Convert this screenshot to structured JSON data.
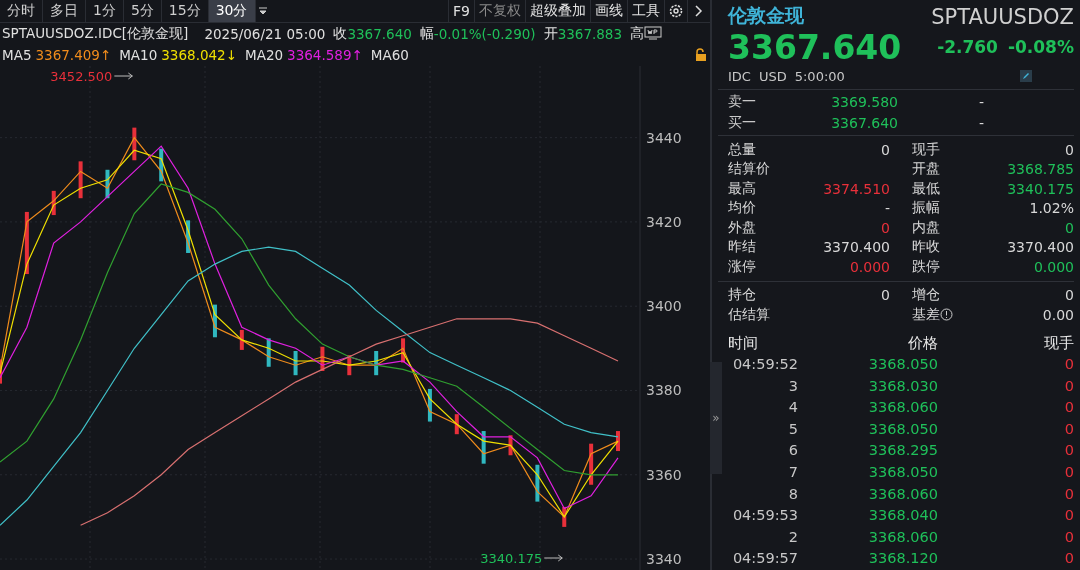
{
  "toolbar": {
    "periods": [
      {
        "label": "分时",
        "selected": false
      },
      {
        "label": "多日",
        "selected": false
      },
      {
        "label": "1分",
        "selected": false
      },
      {
        "label": "5分",
        "selected": false
      },
      {
        "label": "15分",
        "selected": false
      },
      {
        "label": "30分",
        "selected": true
      }
    ],
    "tools": [
      {
        "label": "F9",
        "disabled": false
      },
      {
        "label": "不复权",
        "disabled": true
      },
      {
        "label": "超级叠加",
        "disabled": false
      },
      {
        "label": "画线",
        "disabled": false
      },
      {
        "label": "工具",
        "disabled": false
      }
    ]
  },
  "info_bar": {
    "symbol": "SPTAUUSDOZ.IDC[伦敦金现]",
    "datetime": "2025/06/21 05:00",
    "fields": [
      {
        "label": "收",
        "value": "3367.640",
        "color": "#1fc05a"
      },
      {
        "label": "幅",
        "value": "-0.01%(-0.290)",
        "color": "#1fc05a"
      },
      {
        "label": "开",
        "value": "3367.883",
        "color": "#1fc05a"
      },
      {
        "label": "高"
      }
    ]
  },
  "ma_legend": [
    {
      "name": "MA5",
      "value": "3367.409↑",
      "color": "#f08c1c"
    },
    {
      "name": "MA10",
      "value": "3368.042↓",
      "color": "#f0e000"
    },
    {
      "name": "MA20",
      "value": "3364.589↑",
      "color": "#e020e0"
    },
    {
      "name": "MA60"
    }
  ],
  "chart": {
    "chart_data": {
      "type": "line",
      "ylim": [
        3337.4,
        3457
      ],
      "yticks": [
        3340,
        3360,
        3380,
        3400,
        3420,
        3440
      ],
      "grid": true,
      "series": [
        {
          "color": "#f08c1c",
          "values": [
            3385,
            3420,
            3425,
            3432,
            3428,
            3440,
            3432,
            3415,
            3395,
            3392,
            3388,
            3386,
            3388,
            3386,
            3386,
            3390,
            3375,
            3372,
            3365,
            3367,
            3356,
            3350,
            3365,
            3368
          ]
        },
        {
          "color": "#f0e000",
          "values": [
            3384,
            3410,
            3424,
            3428,
            3430,
            3437,
            3435,
            3418,
            3398,
            3392,
            3390,
            3387,
            3387,
            3386,
            3387,
            3389,
            3378,
            3372,
            3368,
            3367,
            3360,
            3350,
            3360,
            3368
          ]
        },
        {
          "color": "#e020e0",
          "values": [
            3383,
            3395,
            3415,
            3420,
            3426,
            3432,
            3438,
            3428,
            3410,
            3395,
            3392,
            3390,
            3386,
            3388,
            3386,
            3387,
            3382,
            3375,
            3369,
            3369,
            3364,
            3352,
            3355,
            3364
          ]
        },
        {
          "color": "#30a030",
          "values": [
            3363,
            3368,
            3378,
            3392,
            3408,
            3422,
            3429,
            3427,
            3423,
            3416,
            3405,
            3397,
            3391,
            3388,
            3386,
            3385,
            3383,
            3381,
            3376,
            3371,
            3366,
            3361,
            3360,
            3360
          ]
        },
        {
          "color": "#40c0c8",
          "values": [
            3348,
            3354,
            3362,
            3370,
            3380,
            3390,
            3398,
            3406,
            3410,
            3413,
            3414,
            3413,
            3409,
            3405,
            3399,
            3394,
            3389,
            3386,
            3383,
            3380,
            3376,
            3372,
            3370,
            3369
          ]
        },
        {
          "color": "#d87070",
          "values": [
            null,
            null,
            null,
            3348,
            3351,
            3355,
            3360,
            3366,
            3370,
            3374,
            3378,
            3382,
            3385,
            3388,
            3391,
            3393,
            3395,
            3397,
            3397,
            3397,
            3396,
            3393,
            3390,
            3387
          ]
        }
      ],
      "annotations": [
        "3452.500",
        "3340.175"
      ]
    }
  },
  "quote": {
    "name": "伦敦金现",
    "code": "SPTAUUSDOZ",
    "price": "3367.640",
    "change": "-2.760",
    "change_pct": "-0.08%",
    "meta": [
      "IDC",
      "USD",
      "5:00:00"
    ]
  },
  "order_book": [
    {
      "label": "卖一",
      "price": "3369.580",
      "volume": "-"
    },
    {
      "label": "买一",
      "price": "3367.640",
      "volume": "-"
    }
  ],
  "stats": [
    {
      "label": "总量",
      "value": "0"
    },
    {
      "label": "现手",
      "value": "0"
    },
    {
      "label": "结算价"
    },
    {
      "label": "开盘",
      "value": "3368.785",
      "color": "#1fc05a"
    },
    {
      "label": "最高",
      "value": "3374.510",
      "color": "#e8303a"
    },
    {
      "label": "最低",
      "value": "3340.175",
      "color": "#1fc05a"
    },
    {
      "label": "均价",
      "value": "-"
    },
    {
      "label": "振幅",
      "value": "1.02%"
    },
    {
      "label": "外盘",
      "value": "0",
      "color": "#e8303a"
    },
    {
      "label": "内盘",
      "value": "0",
      "color": "#1fc05a"
    },
    {
      "label": "昨结",
      "value": "3370.400"
    },
    {
      "label": "昨收",
      "value": "3370.400"
    },
    {
      "label": "涨停",
      "value": "0.000",
      "color": "#e8303a"
    },
    {
      "label": "跌停",
      "value": "0.000",
      "color": "#1fc05a"
    }
  ],
  "position_stats": [
    {
      "label": "持仓",
      "value": "0"
    },
    {
      "label": "增仓",
      "value": "0"
    },
    {
      "label": "估结算"
    },
    {
      "label": "基差",
      "value": "0.00",
      "info": true
    }
  ],
  "trades": {
    "columns": [
      "时间",
      "价格",
      "现手"
    ],
    "rows": [
      {
        "time": "04:59:52",
        "price": "3368.050",
        "volume": "0"
      },
      {
        "time": "3",
        "price": "3368.030",
        "volume": "0"
      },
      {
        "time": "4",
        "price": "3368.060",
        "volume": "0"
      },
      {
        "time": "5",
        "price": "3368.050",
        "volume": "0"
      },
      {
        "time": "6",
        "price": "3368.295",
        "volume": "0"
      },
      {
        "time": "7",
        "price": "3368.050",
        "volume": "0"
      },
      {
        "time": "8",
        "price": "3368.060",
        "volume": "0"
      },
      {
        "time": "04:59:53",
        "price": "3368.040",
        "volume": "0"
      },
      {
        "time": "2",
        "price": "3368.060",
        "volume": "0"
      },
      {
        "time": "04:59:57",
        "price": "3368.120",
        "volume": "0"
      }
    ]
  },
  "collapse_handle": "»"
}
